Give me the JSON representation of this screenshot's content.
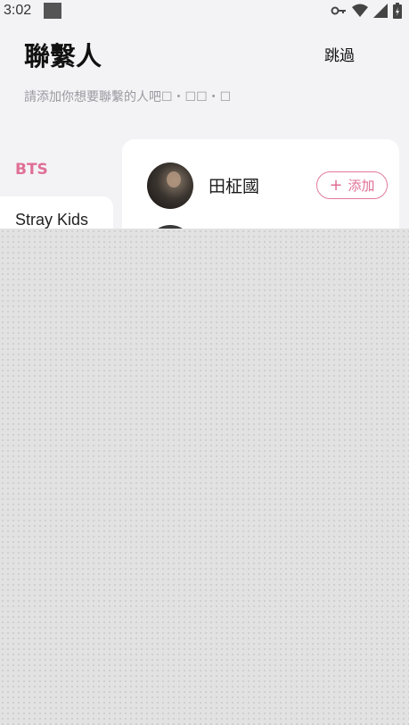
{
  "status_bar": {
    "time": "3:02",
    "icons": [
      "notification-square-icon",
      "key-icon",
      "wifi-icon",
      "signal-icon",
      "battery-icon"
    ]
  },
  "header": {
    "title": "聯繫人",
    "skip_label": "跳過"
  },
  "subtitle": "請添加你想要聯繫的人吧☐・☐☐・☐",
  "groups": [
    {
      "label": "BTS",
      "active": true
    },
    {
      "label": "Stray Kids",
      "active": false
    }
  ],
  "members": [
    {
      "name": "田柾國",
      "add_label": "添加"
    }
  ],
  "colors": {
    "accent": "#e06f95",
    "background": "#f3f3f6",
    "panel": "#ffffff"
  }
}
